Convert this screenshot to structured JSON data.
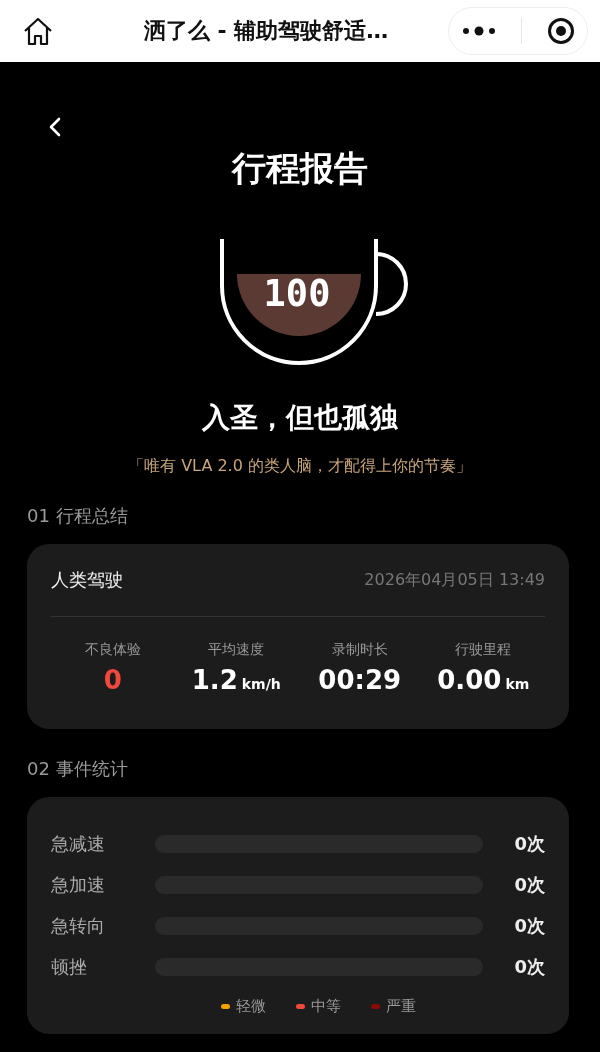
{
  "nav": {
    "title": "洒了么 - 辅助驾驶舒适…"
  },
  "header": {
    "title": "行程报告",
    "score": "100",
    "headline": "入圣，但也孤独",
    "quote": "「唯有 VLA 2.0 的类人脑，才配得上你的节奏」"
  },
  "summary": {
    "heading": "01 行程总结",
    "mode": "人类驾驶",
    "datetime": "2026年04月05日 13:49",
    "stats": [
      {
        "label": "不良体验",
        "value": "0",
        "alert": true
      },
      {
        "label": "平均速度",
        "value": "1.2",
        "unit": "km/h",
        "alert": false
      },
      {
        "label": "录制时长",
        "value": "00:29",
        "alert": false
      },
      {
        "label": "行驶里程",
        "value": "0.00",
        "unit": "km",
        "alert": false
      }
    ]
  },
  "events": {
    "heading": "02 事件统计",
    "rows": [
      {
        "name": "急减速",
        "level": 0,
        "count": "0次"
      },
      {
        "name": "急加速",
        "level": 0,
        "count": "0次"
      },
      {
        "name": "急转向",
        "level": 0,
        "count": "0次"
      },
      {
        "name": "顿挫",
        "level": 0,
        "count": "0次"
      }
    ],
    "legend": [
      {
        "label": "轻微",
        "color": "#f5a000"
      },
      {
        "label": "中等",
        "color": "#f0483c"
      },
      {
        "label": "严重",
        "color": "#8b0a0a"
      }
    ]
  }
}
